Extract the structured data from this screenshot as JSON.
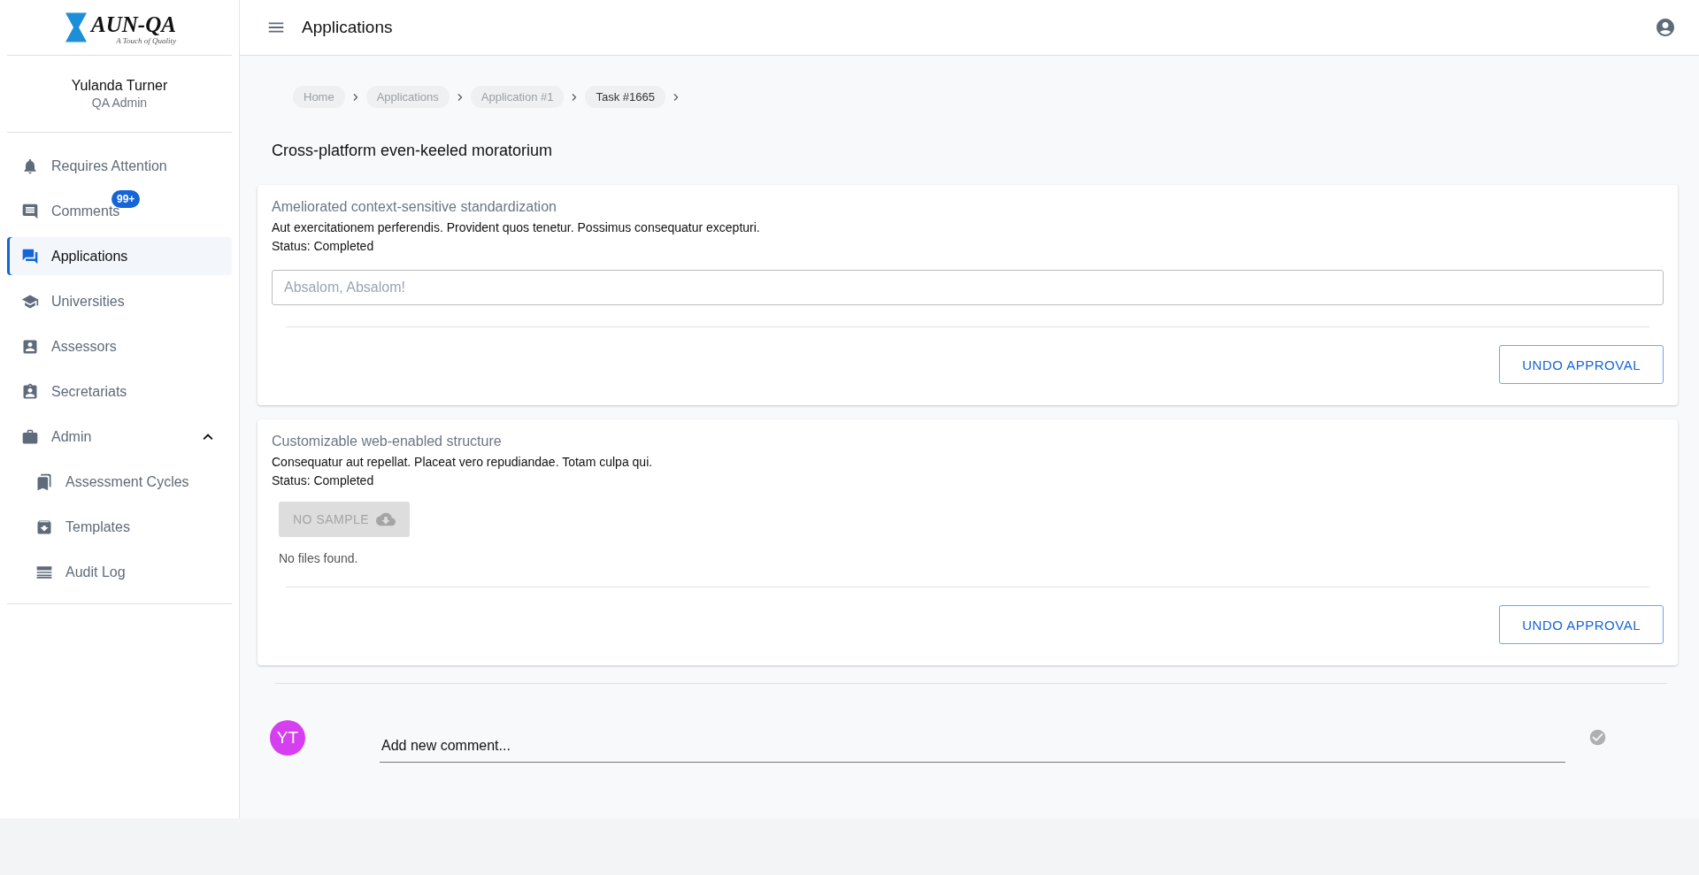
{
  "logo": {
    "mark": "AUN-QA",
    "tagline": "A Touch of Quality"
  },
  "user": {
    "name": "Yulanda Turner",
    "role": "QA Admin"
  },
  "sidebar": {
    "items": [
      {
        "label": "Requires Attention",
        "selected": false
      },
      {
        "label": "Comments",
        "selected": false,
        "badge": "99+"
      },
      {
        "label": "Applications",
        "selected": true
      },
      {
        "label": "Universities",
        "selected": false
      },
      {
        "label": "Assessors",
        "selected": false
      },
      {
        "label": "Secretariats",
        "selected": false
      },
      {
        "label": "Admin",
        "selected": false,
        "expanded": true,
        "children": [
          {
            "label": "Assessment Cycles",
            "selected": false
          },
          {
            "label": "Templates",
            "selected": false
          },
          {
            "label": "Audit Log",
            "selected": false
          }
        ]
      }
    ]
  },
  "topbar": {
    "title": "Applications"
  },
  "breadcrumbs": [
    {
      "label": "Home",
      "selected": false
    },
    {
      "label": "Applications",
      "selected": false
    },
    {
      "label": "Application #1",
      "selected": false
    },
    {
      "label": "Task #1665",
      "selected": true
    }
  ],
  "page_title": "Cross-platform even-keeled moratorium",
  "cards": [
    {
      "kind": "text_input",
      "title": "Ameliorated context-sensitive standardization",
      "description": "Aut exercitationem perferendis. Provident quos tenetur. Possimus consequatur excepturi.",
      "status": "Status: Completed",
      "placeholder": "Absalom, Absalom!",
      "button": "UNDO APPROVAL"
    },
    {
      "kind": "sample",
      "title": "Customizable web-enabled structure",
      "description": "Consequatur aut repellat. Placeat vero repudiandae. Totam culpa qui.",
      "status": "Status: Completed",
      "sample_button": {
        "label": "NO SAMPLE",
        "disabled": true
      },
      "files_note": "No files found.",
      "button": "UNDO APPROVAL"
    }
  ],
  "comment": {
    "avatar": "YT",
    "placeholder": "Add new comment..."
  }
}
